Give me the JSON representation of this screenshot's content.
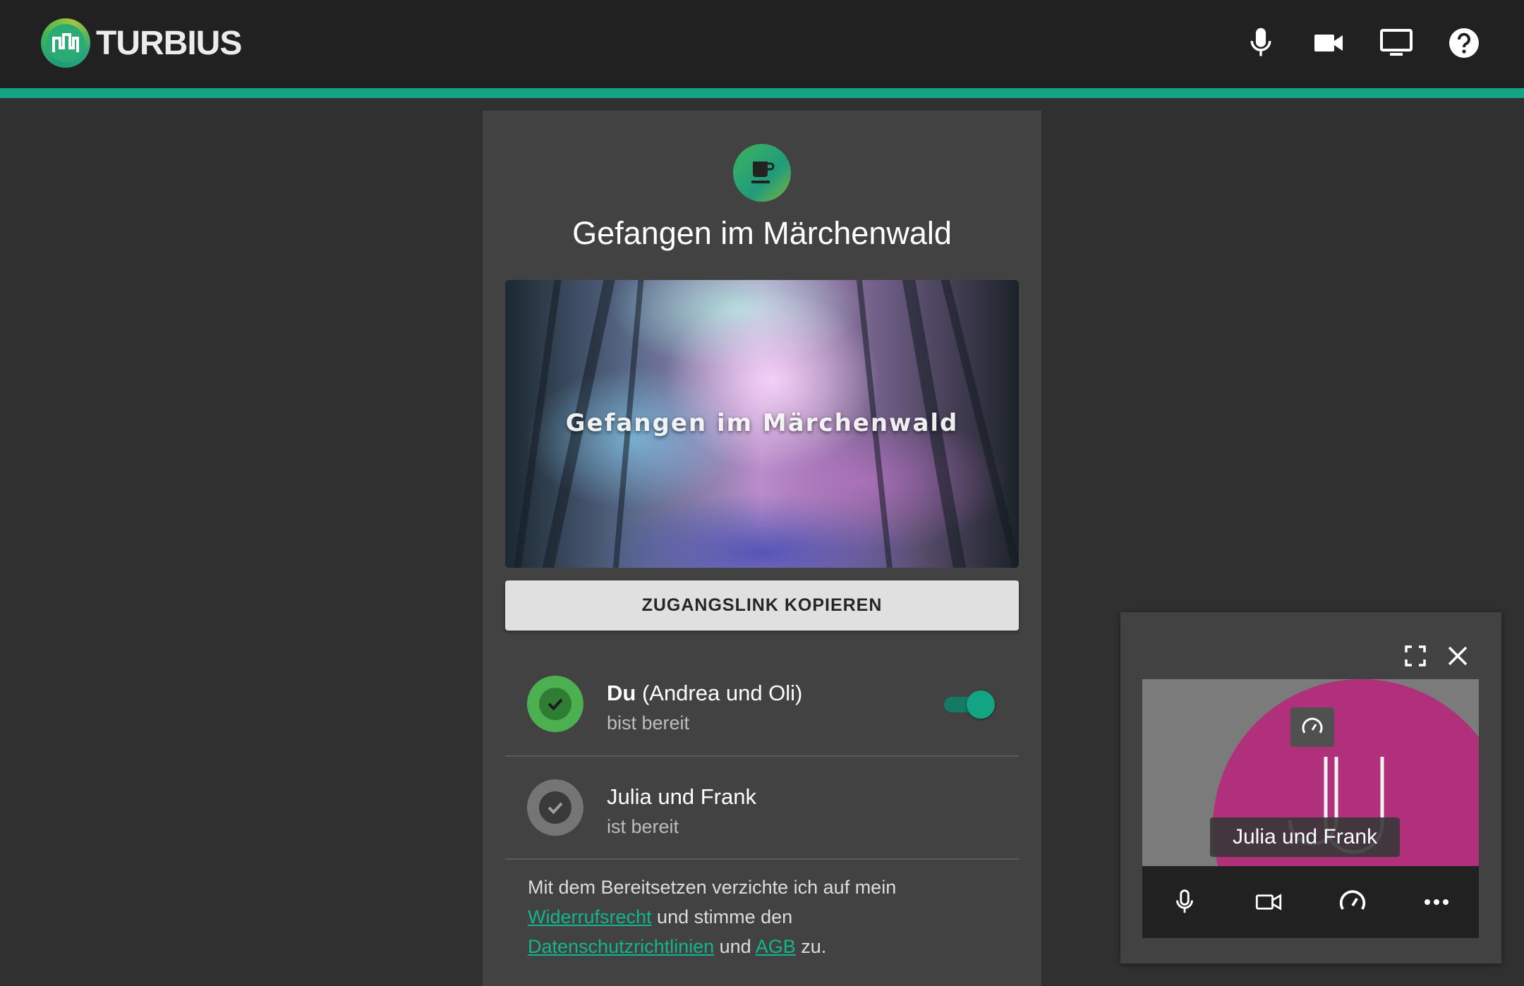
{
  "header": {
    "brand": "TURBIUS",
    "icons": [
      "microphone-icon",
      "video-camera-icon",
      "screen-share-icon",
      "help-icon"
    ]
  },
  "colors": {
    "accent": "#13a483",
    "background": "#303030",
    "card": "#424242",
    "topbar": "#212121",
    "avatar": "#b0307c"
  },
  "room": {
    "title": "Gefangen im Märchenwald",
    "badge_icon": "coffee-cup-icon",
    "image_title": "Gefangen im Märchenwald",
    "copy_button_label": "ZUGANGSLINK KOPIEREN"
  },
  "participants": [
    {
      "name_bold": "Du",
      "name": " (Andrea und Oli)",
      "status": "bist bereit",
      "ready_toggle": true
    },
    {
      "name_bold": "",
      "name": "Julia und Frank",
      "status": "ist bereit"
    }
  ],
  "consent": {
    "text_1": "Mit dem Bereitsetzen verzichte ich auf mein",
    "link_1": "Widerrufsrecht",
    "text_2": " und stimme den",
    "link_2": "Datenschutzrichtlinien",
    "text_3": " und ",
    "link_3": "AGB",
    "text_4": " zu."
  },
  "video_panel": {
    "participant_name": "Julia und Frank",
    "controls": [
      "microphone-icon",
      "video-camera-icon",
      "speedometer-icon",
      "more-icon"
    ]
  }
}
